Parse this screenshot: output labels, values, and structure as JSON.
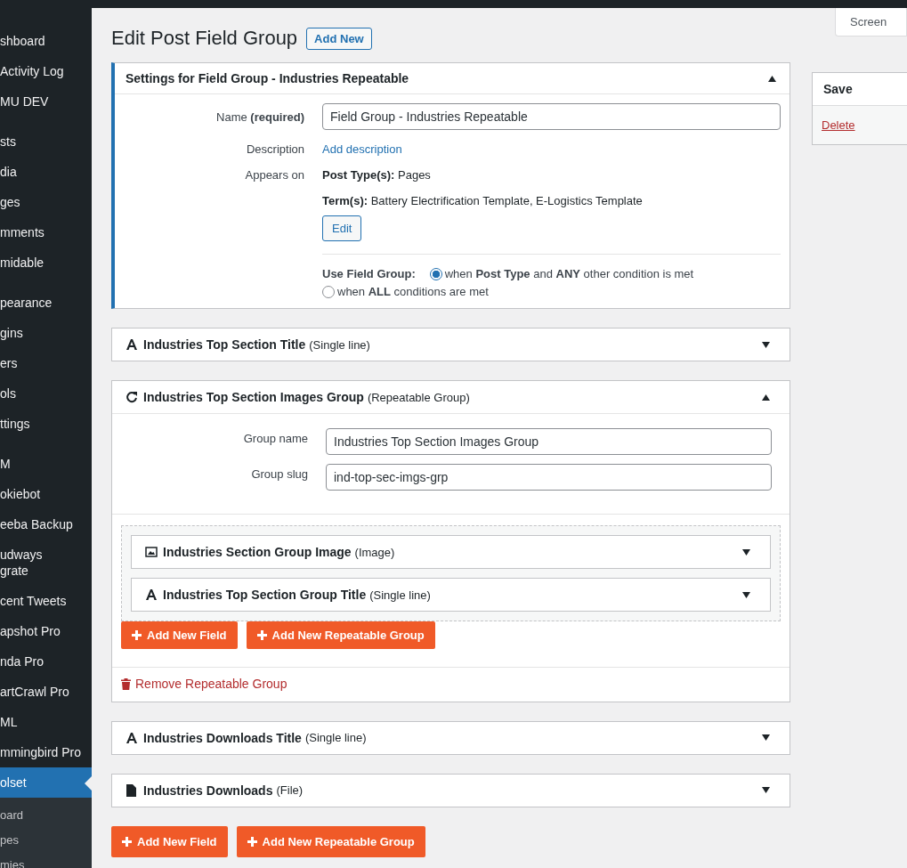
{
  "sidebar": {
    "groups": [
      [
        {
          "label": "shboard",
          "selected": false
        },
        {
          "label": "Activity Log",
          "selected": false
        },
        {
          "label": "MU DEV",
          "selected": false
        }
      ],
      [
        {
          "label": "sts",
          "selected": false
        },
        {
          "label": "dia",
          "selected": false
        },
        {
          "label": "ges",
          "selected": false
        },
        {
          "label": "mments",
          "selected": false
        },
        {
          "label": "midable",
          "selected": false
        }
      ],
      [
        {
          "label": "pearance",
          "selected": false
        },
        {
          "label": "gins",
          "selected": false
        },
        {
          "label": "ers",
          "selected": false
        },
        {
          "label": "ols",
          "selected": false
        },
        {
          "label": "ttings",
          "selected": false
        }
      ],
      [
        {
          "label": "M",
          "selected": false
        },
        {
          "label": "okiebot",
          "selected": false
        },
        {
          "label": "eeba Backup",
          "selected": false
        },
        {
          "label": "udways\ngrate",
          "selected": false
        },
        {
          "label": "cent Tweets",
          "selected": false
        },
        {
          "label": "apshot Pro",
          "selected": false
        },
        {
          "label": "nda Pro",
          "selected": false
        },
        {
          "label": "artCrawl Pro",
          "selected": false
        },
        {
          "label": "ML",
          "selected": false
        },
        {
          "label": "mmingbird Pro",
          "selected": false
        },
        {
          "label": "olset",
          "selected": true
        }
      ]
    ],
    "submenu": [
      "oard",
      "pes",
      "mies"
    ]
  },
  "screen_options": "Screen",
  "page": {
    "title": "Edit Post Field Group",
    "add_new": "Add New"
  },
  "settings": {
    "title": "Settings for Field Group - Industries Repeatable",
    "expanded": true,
    "name_label": "Name **(required)**",
    "name_value": "Field Group - Industries Repeatable",
    "description_label": "Description",
    "description_link": "Add description",
    "appears_label": "Appears on",
    "post_types": "**Post Type(s):** Pages",
    "terms": "**Term(s):** Battery Electrification Template, E-Logistics Template",
    "edit_button": "Edit",
    "use_label": "Use Field Group:",
    "options": [
      {
        "label": "when **Post Type** and **ANY** other condition is met",
        "selected": true
      },
      {
        "label": "when **ALL** conditions are met",
        "selected": false
      }
    ]
  },
  "fields": [
    {
      "kind": "text",
      "name": "Industries Top Section Title",
      "type": "(Single line)",
      "expanded": false
    },
    {
      "kind": "repeatable",
      "name": "Industries Top Section Images Group",
      "type": "(Repeatable Group)",
      "expanded": true,
      "group_name_label": "Group name",
      "group_name": "Industries Top Section Images Group",
      "group_slug_label": "Group slug",
      "group_slug": "ind-top-sec-imgs-grp",
      "children": [
        {
          "kind": "image",
          "name": "Industries Section Group Image",
          "type": "(Image)",
          "expanded": false
        },
        {
          "kind": "text",
          "name": "Industries Top Section Group Title",
          "type": "(Single line)",
          "expanded": false
        }
      ],
      "buttons": [
        "Add New Field",
        "Add New Repeatable Group"
      ],
      "remove": "Remove Repeatable Group"
    },
    {
      "kind": "text",
      "name": "Industries Downloads Title",
      "type": "(Single line)",
      "expanded": false
    },
    {
      "kind": "file",
      "name": "Industries Downloads",
      "type": "(File)",
      "expanded": false
    }
  ],
  "buttons": [
    "Add New Field",
    "Add New Repeatable Group"
  ],
  "save_box": {
    "title": "Save",
    "delete": "Delete"
  }
}
